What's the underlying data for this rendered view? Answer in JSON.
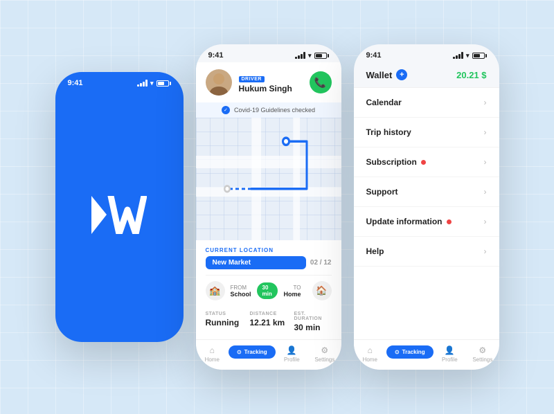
{
  "background": "#d6e8f7",
  "phone1": {
    "status_time": "9:41",
    "logo_text": "AV"
  },
  "phone2": {
    "status_time": "9:41",
    "driver": {
      "badge": "DRIVER",
      "name": "Hukum Singh"
    },
    "covid": "Covid-19 Guidelines checked",
    "location_label": "CURRENT LOCATION",
    "location_name": "New Market",
    "location_count": "02 / 12",
    "from_label": "FROM",
    "from_place": "School",
    "duration": "30 min",
    "to_label": "TO",
    "to_place": "Home",
    "status_label": "STATUS",
    "status_value": "Running",
    "distance_label": "DISTANCE",
    "distance_value": "12.21 km",
    "duration_label": "EST. DURATION",
    "duration_value": "30 min",
    "nav": {
      "home": "Home",
      "tracking": "Tracking",
      "profile": "Profile",
      "settings": "Settings"
    }
  },
  "phone3": {
    "status_time": "9:41",
    "wallet_label": "Wallet",
    "wallet_amount": "20.21 $",
    "menu_items": [
      {
        "label": "Calendar",
        "has_dot": false
      },
      {
        "label": "Trip history",
        "has_dot": false
      },
      {
        "label": "Subscription",
        "has_dot": true
      },
      {
        "label": "Support",
        "has_dot": false
      },
      {
        "label": "Update information",
        "has_dot": true
      },
      {
        "label": "Help",
        "has_dot": false
      }
    ],
    "nav": {
      "home": "Home",
      "tracking": "Tracking",
      "profile": "Profile",
      "settings": "Settings"
    }
  }
}
